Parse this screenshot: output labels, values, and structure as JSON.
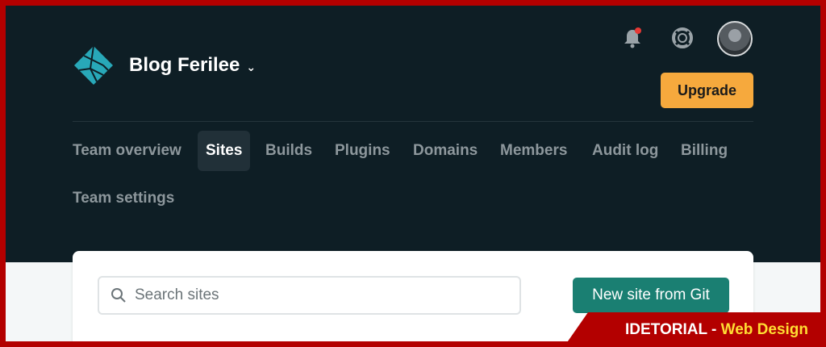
{
  "team": {
    "name": "Blog Ferilee",
    "dropdown_icon": "chevron-down-icon"
  },
  "header": {
    "notification_dot_color": "#e53935",
    "upgrade_label": "Upgrade"
  },
  "nav": {
    "items": [
      {
        "label": "Team overview",
        "active": false
      },
      {
        "label": "Sites",
        "active": true
      },
      {
        "label": "Builds",
        "active": false
      },
      {
        "label": "Plugins",
        "active": false
      },
      {
        "label": "Domains",
        "active": false
      },
      {
        "label": "Members",
        "active": false
      },
      {
        "label": "Audit log",
        "active": false
      },
      {
        "label": "Billing",
        "active": false
      },
      {
        "label": "Team settings",
        "active": false
      }
    ]
  },
  "sites": {
    "search_placeholder": "Search sites",
    "search_value": "",
    "new_site_label": "New site from Git"
  },
  "watermark": {
    "brand": "IDETORIAL - ",
    "topic": "Web Design"
  },
  "colors": {
    "header_bg": "#0e1e25",
    "upgrade_bg": "#f6a93d",
    "primary_button": "#1a7f72",
    "frame": "#b30000",
    "logo": "#28a8b8"
  }
}
